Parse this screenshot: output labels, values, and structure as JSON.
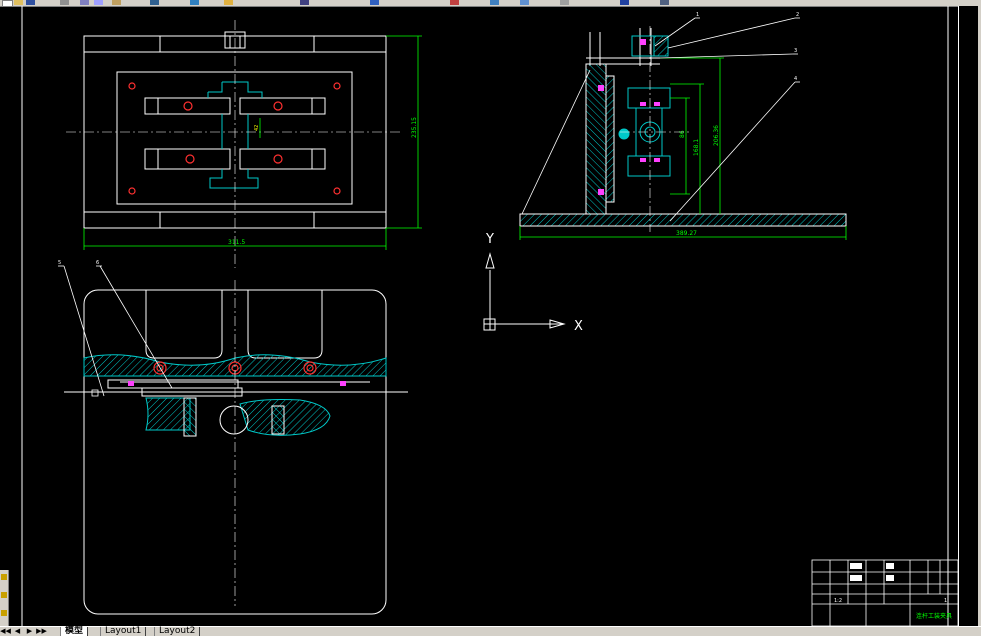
{
  "toolbar": {
    "icons": [
      "new-icon",
      "open-icon",
      "save-icon",
      "print-icon",
      "cut-icon",
      "copy-icon",
      "paste-icon",
      "undo-icon",
      "redo-icon",
      "pan-icon",
      "zoom-icon",
      "properties-icon"
    ]
  },
  "drawing": {
    "colors": {
      "background": "#000000",
      "outline": "#ffffff",
      "dimension": "#00ff00",
      "hatch": "#00c8c8",
      "centerline": "#ffffff",
      "bolt": "#ff3030",
      "pin": "#ff40ff",
      "yellow": "#ffff00"
    },
    "top_view": {
      "width_dim": "311.5",
      "height_dim": "235.15",
      "inner_dim": "42"
    },
    "side_view": {
      "base_dim": "389.27",
      "height_dim_1": "206.36",
      "height_dim_2": "168.1",
      "height_dim_3": "86"
    },
    "leaders": [
      "1",
      "2",
      "3",
      "4"
    ],
    "front_leaders": [
      "5",
      "6"
    ]
  },
  "ucs": {
    "y_label": "Y",
    "x_label": "X"
  },
  "title_block": {
    "title": "连杆工装夹具",
    "scale": "1:2",
    "sheet": "1"
  },
  "tabs": {
    "nav": [
      "◀◀",
      "◀",
      "▶",
      "▶▶"
    ],
    "items": [
      "模型",
      "Layout1",
      "Layout2"
    ],
    "active": 0
  },
  "sidebar": {
    "icons": [
      "layer-icon",
      "properties-icon",
      "design-center-icon"
    ]
  }
}
